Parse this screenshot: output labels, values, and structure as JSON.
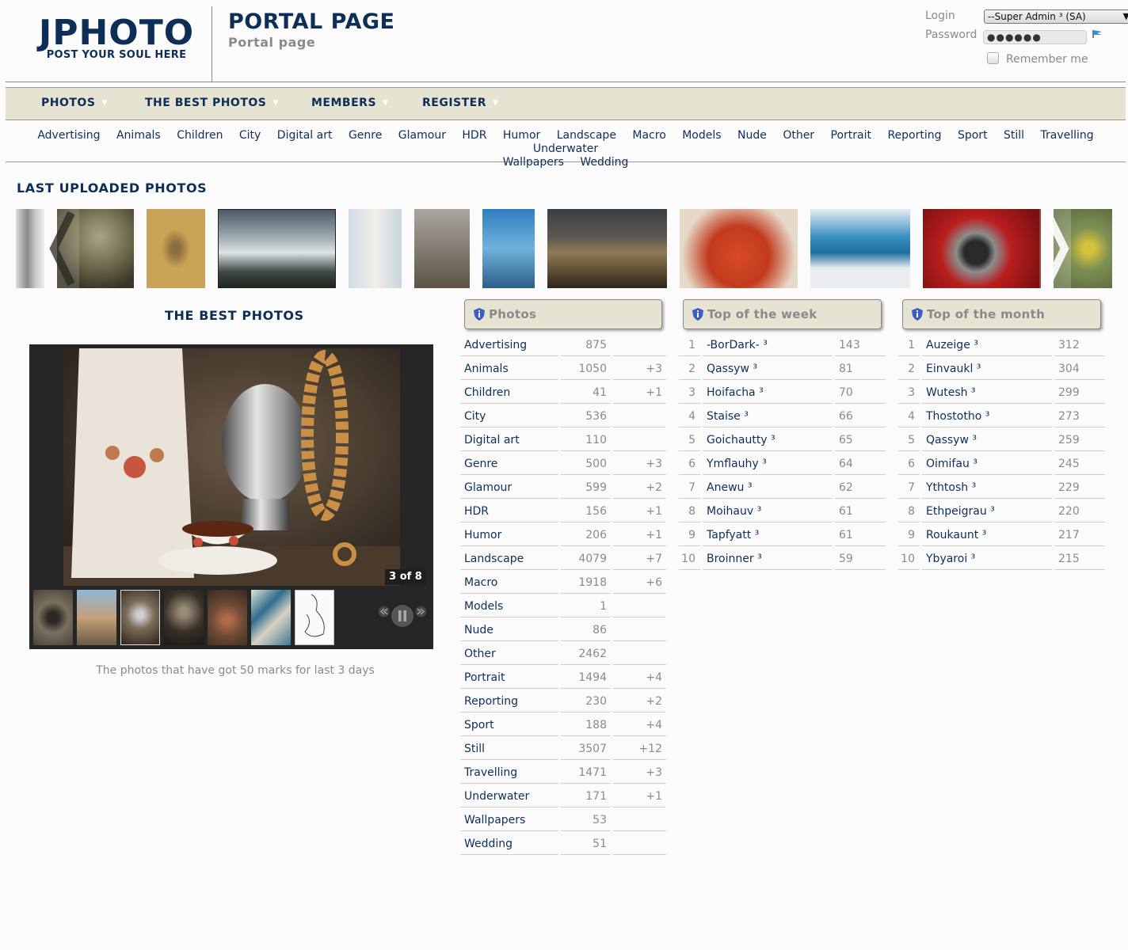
{
  "logo": {
    "title": "JPHOTO",
    "tagline": "POST YOUR SOUL HERE"
  },
  "page": {
    "title": "PORTAL PAGE",
    "subtitle": "Portal page"
  },
  "login": {
    "login_label": "Login",
    "login_value": "--Super Admin ³ (SA)",
    "password_label": "Password",
    "password_value": "●●●●●●",
    "remember_label": "Remember me"
  },
  "mainnav": [
    {
      "label": "PHOTOS"
    },
    {
      "label": "THE BEST PHOTOS"
    },
    {
      "label": "MEMBERS"
    },
    {
      "label": "REGISTER"
    }
  ],
  "categories_bar": [
    "Advertising",
    "Animals",
    "Children",
    "City",
    "Digital art",
    "Genre",
    "Glamour",
    "HDR",
    "Humor",
    "Landscape",
    "Macro",
    "Models",
    "Nude",
    "Other",
    "Portrait",
    "Reporting",
    "Sport",
    "Still",
    "Travelling",
    "Underwater",
    "Wallpapers",
    "Wedding"
  ],
  "sections": {
    "last_uploaded": "LAST UPLOADED PHOTOS",
    "best_photos": "THE BEST PHOTOS"
  },
  "slideshow": {
    "counter": "3 of 8",
    "caption": "The photos that have got 50 marks for last 3 days"
  },
  "photos_table": {
    "title": "Photos",
    "rows": [
      {
        "name": "Advertising",
        "count": "875",
        "delta": ""
      },
      {
        "name": "Animals",
        "count": "1050",
        "delta": "+3"
      },
      {
        "name": "Children",
        "count": "41",
        "delta": "+1"
      },
      {
        "name": "City",
        "count": "536",
        "delta": ""
      },
      {
        "name": "Digital art",
        "count": "110",
        "delta": ""
      },
      {
        "name": "Genre",
        "count": "500",
        "delta": "+3"
      },
      {
        "name": "Glamour",
        "count": "599",
        "delta": "+2"
      },
      {
        "name": "HDR",
        "count": "156",
        "delta": "+1"
      },
      {
        "name": "Humor",
        "count": "206",
        "delta": "+1"
      },
      {
        "name": "Landscape",
        "count": "4079",
        "delta": "+7"
      },
      {
        "name": "Macro",
        "count": "1918",
        "delta": "+6"
      },
      {
        "name": "Models",
        "count": "1",
        "delta": ""
      },
      {
        "name": "Nude",
        "count": "86",
        "delta": ""
      },
      {
        "name": "Other",
        "count": "2462",
        "delta": ""
      },
      {
        "name": "Portrait",
        "count": "1494",
        "delta": "+4"
      },
      {
        "name": "Reporting",
        "count": "230",
        "delta": "+2"
      },
      {
        "name": "Sport",
        "count": "188",
        "delta": "+4"
      },
      {
        "name": "Still",
        "count": "3507",
        "delta": "+12"
      },
      {
        "name": "Travelling",
        "count": "1471",
        "delta": "+3"
      },
      {
        "name": "Underwater",
        "count": "171",
        "delta": "+1"
      },
      {
        "name": "Wallpapers",
        "count": "53",
        "delta": ""
      },
      {
        "name": "Wedding",
        "count": "51",
        "delta": ""
      }
    ]
  },
  "top_week": {
    "title": "Top of the week",
    "rows": [
      {
        "rank": "1",
        "name": "-BorDark- ³",
        "score": "143"
      },
      {
        "rank": "2",
        "name": "Qassyw ³",
        "score": "81"
      },
      {
        "rank": "3",
        "name": "Hoifacha ³",
        "score": "70"
      },
      {
        "rank": "4",
        "name": "Staise ³",
        "score": "66"
      },
      {
        "rank": "5",
        "name": "Goichautty ³",
        "score": "65"
      },
      {
        "rank": "6",
        "name": "Ymflauhy ³",
        "score": "64"
      },
      {
        "rank": "7",
        "name": "Anewu ³",
        "score": "62"
      },
      {
        "rank": "8",
        "name": "Moihauv ³",
        "score": "61"
      },
      {
        "rank": "9",
        "name": "Tapfyatt ³",
        "score": "61"
      },
      {
        "rank": "10",
        "name": "Broinner ³",
        "score": "59"
      }
    ]
  },
  "top_month": {
    "title": "Top of the month",
    "rows": [
      {
        "rank": "1",
        "name": "Auzeige ³",
        "score": "312"
      },
      {
        "rank": "2",
        "name": "Einvaukl ³",
        "score": "304"
      },
      {
        "rank": "3",
        "name": "Wutesh ³",
        "score": "299"
      },
      {
        "rank": "4",
        "name": "Thostotho ³",
        "score": "273"
      },
      {
        "rank": "5",
        "name": "Qassyw ³",
        "score": "259"
      },
      {
        "rank": "6",
        "name": "Oimifau ³",
        "score": "245"
      },
      {
        "rank": "7",
        "name": "Ythtosh ³",
        "score": "229"
      },
      {
        "rank": "8",
        "name": "Ethpeigrau ³",
        "score": "220"
      },
      {
        "rank": "9",
        "name": "Roukaunt ³",
        "score": "217"
      },
      {
        "rank": "10",
        "name": "Ybyaroi ³",
        "score": "215"
      }
    ]
  },
  "colors": {
    "brand": "#0d2f57",
    "nav_bg": "#e7e3d3",
    "muted": "#8a8a8a"
  }
}
